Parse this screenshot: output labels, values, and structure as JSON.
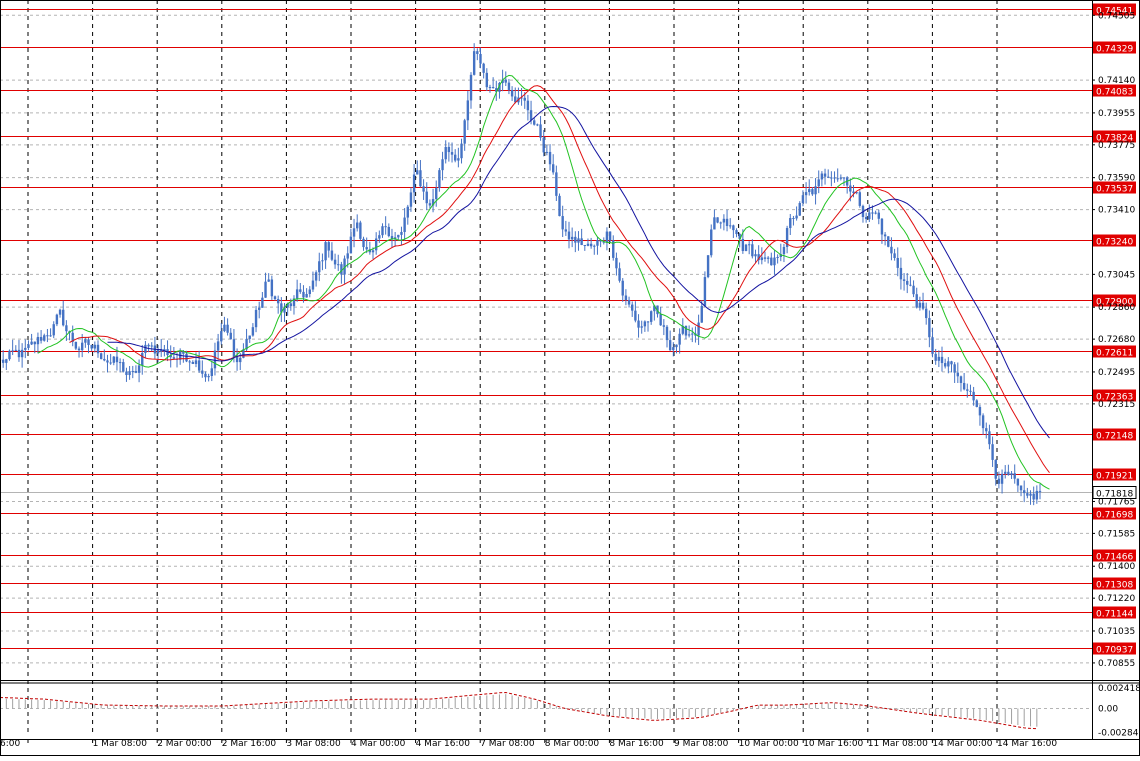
{
  "chart_data": {
    "type": "candlestick",
    "title": "",
    "grid": true,
    "colors": {
      "candle": "#4472c4",
      "ma_fast": "#22c322",
      "ma_mid": "#e01010",
      "ma_slow": "#1414a0",
      "level": "#e00000",
      "grid": "#b4b4b4",
      "oscillator": "#c00000",
      "bid_line": "#b4b4b4"
    },
    "y_axis": {
      "range": [
        0.7077,
        0.7458
      ],
      "ticks": [
        "0.74505",
        "0.74140",
        "0.73955",
        "0.73775",
        "0.73590",
        "0.73410",
        "0.73045",
        "0.72860",
        "0.72680",
        "0.72495",
        "0.72315",
        "0.71765",
        "0.71585",
        "0.71400",
        "0.71220",
        "0.71035",
        "0.70855"
      ],
      "current_price": "0.71818"
    },
    "x_axis": {
      "ticks": [
        "6:00",
        "1 Mar 08:00",
        "2 Mar 00:00",
        "2 Mar 16:00",
        "3 Mar 08:00",
        "4 Mar 00:00",
        "4 Mar 16:00",
        "7 Mar 08:00",
        "8 Mar 00:00",
        "8 Mar 16:00",
        "9 Mar 08:00",
        "10 Mar 00:00",
        "10 Mar 16:00",
        "11 Mar 08:00",
        "14 Mar 00:00",
        "14 Mar 16:00"
      ]
    },
    "levels": [
      "0.74541",
      "0.74329",
      "0.74083",
      "0.73824",
      "0.73537",
      "0.73240",
      "0.72900",
      "0.72611",
      "0.72363",
      "0.72148",
      "0.71921",
      "0.71698",
      "0.71466",
      "0.71308",
      "0.71144",
      "0.70937"
    ],
    "anchors": [
      [
        0,
        0.7255
      ],
      [
        2,
        0.726
      ],
      [
        4,
        0.728
      ],
      [
        5,
        0.7265
      ],
      [
        7,
        0.726
      ],
      [
        9,
        0.7245
      ],
      [
        10,
        0.7265
      ],
      [
        12,
        0.7258
      ],
      [
        13,
        0.726
      ],
      [
        14,
        0.725
      ],
      [
        15,
        0.7275
      ],
      [
        16,
        0.7255
      ],
      [
        17,
        0.7275
      ],
      [
        18,
        0.73
      ],
      [
        19,
        0.7282
      ],
      [
        20,
        0.729
      ],
      [
        21,
        0.7295
      ],
      [
        22,
        0.7322
      ],
      [
        23,
        0.7305
      ],
      [
        24,
        0.7335
      ],
      [
        25,
        0.7312
      ],
      [
        26,
        0.733
      ],
      [
        27,
        0.7326
      ],
      [
        28,
        0.736
      ],
      [
        29,
        0.7342
      ],
      [
        30,
        0.7378
      ],
      [
        31,
        0.7372
      ],
      [
        32,
        0.743
      ],
      [
        33,
        0.7408
      ],
      [
        34,
        0.7418
      ],
      [
        35,
        0.7405
      ],
      [
        36,
        0.739
      ],
      [
        37,
        0.7368
      ],
      [
        38,
        0.7325
      ],
      [
        39,
        0.7322
      ],
      [
        40,
        0.7318
      ],
      [
        41,
        0.733
      ],
      [
        42,
        0.7292
      ],
      [
        43,
        0.7275
      ],
      [
        44,
        0.7282
      ],
      [
        45,
        0.7265
      ],
      [
        46,
        0.727
      ],
      [
        47,
        0.7275
      ],
      [
        48,
        0.733
      ],
      [
        49,
        0.733
      ],
      [
        50,
        0.732
      ],
      [
        51,
        0.7315
      ],
      [
        52,
        0.7305
      ],
      [
        53,
        0.733
      ],
      [
        54,
        0.7345
      ],
      [
        55,
        0.7352
      ],
      [
        56,
        0.7365
      ],
      [
        57,
        0.736
      ],
      [
        58,
        0.7342
      ],
      [
        59,
        0.7338
      ],
      [
        60,
        0.7315
      ],
      [
        61,
        0.73
      ],
      [
        62,
        0.7285
      ],
      [
        63,
        0.7255
      ],
      [
        64,
        0.725
      ],
      [
        65,
        0.7237
      ],
      [
        66,
        0.723
      ],
      [
        67,
        0.7195
      ],
      [
        68,
        0.7188
      ],
      [
        69,
        0.7172
      ],
      [
        70,
        0.7182
      ]
    ],
    "oscillator": {
      "ticks": [
        "0.002418",
        "0.00",
        "-0.002847"
      ],
      "range": [
        -0.003,
        0.003
      ],
      "shape": [
        [
          0,
          0.0013
        ],
        [
          3,
          0.0011
        ],
        [
          7,
          0.0004
        ],
        [
          11,
          0.0003
        ],
        [
          15,
          0.0003
        ],
        [
          17,
          0.0005
        ],
        [
          21,
          0.0009
        ],
        [
          25,
          0.0011
        ],
        [
          29,
          0.0011
        ],
        [
          32,
          0.0016
        ],
        [
          34,
          0.0019
        ],
        [
          36,
          0.0011
        ],
        [
          38,
          0.0
        ],
        [
          41,
          -0.0009
        ],
        [
          44,
          -0.0014
        ],
        [
          47,
          -0.0011
        ],
        [
          49,
          -0.0004
        ],
        [
          51,
          0.0004
        ],
        [
          53,
          0.0004
        ],
        [
          56,
          0.0007
        ],
        [
          58,
          0.0004
        ],
        [
          62,
          -0.0006
        ],
        [
          66,
          -0.0014
        ],
        [
          69,
          -0.0023
        ],
        [
          70,
          -0.0024
        ]
      ]
    }
  }
}
